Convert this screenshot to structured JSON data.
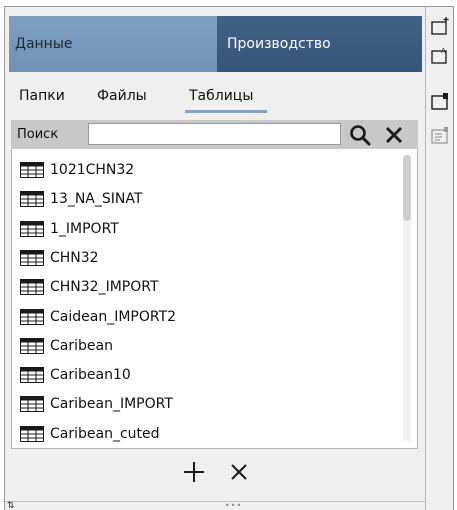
{
  "mode_tabs": [
    {
      "label": "Данные",
      "active": true
    },
    {
      "label": "Производство",
      "active": false
    }
  ],
  "subtabs": [
    {
      "label": "Папки"
    },
    {
      "label": "Файлы"
    },
    {
      "label": "Таблицы",
      "active": true
    }
  ],
  "search": {
    "label": "Поиск",
    "value": "",
    "placeholder": ""
  },
  "list": {
    "items": [
      "1021CHN32",
      "13_NA_SINAT",
      "1_IMPORT",
      "CHN32",
      "CHN32_IMPORT",
      "Caidean_IMPORT2",
      "Caribean",
      "Caribean10",
      "Caribean_IMPORT",
      "Caribean_cuted"
    ],
    "item_icon": "table-icon",
    "scroll_position": 0.0
  },
  "actions": {
    "add_icon": "plus-icon",
    "remove_icon": "close-icon"
  },
  "toolbar": {
    "icons": [
      "add-window-icon",
      "rename-window-icon",
      "new-window-icon",
      "notes-icon"
    ]
  },
  "colors": {
    "data_tab": "#7698bb",
    "production_tab": "#3b5d81",
    "subtab_underline": "#7aa6cf",
    "search_bar": "#c8c8c8",
    "panel_bg": "#efefef"
  }
}
